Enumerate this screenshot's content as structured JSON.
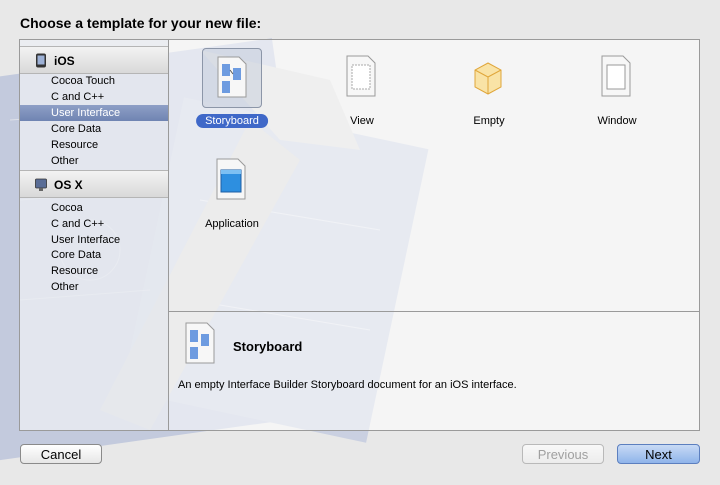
{
  "dialog": {
    "title": "Choose a template for your new file:"
  },
  "sidebar": {
    "groups": [
      {
        "label": "iOS",
        "icon": "ios-device-icon",
        "items": [
          "Cocoa Touch",
          "C and C++",
          "User Interface",
          "Core Data",
          "Resource",
          "Other"
        ],
        "selected_index": 2
      },
      {
        "label": "OS X",
        "icon": "mac-icon",
        "items": [
          "Cocoa",
          "C and C++",
          "User Interface",
          "Core Data",
          "Resource",
          "Other"
        ]
      }
    ]
  },
  "templates": [
    {
      "label": "Storyboard",
      "icon": "storyboard-icon",
      "selected": true
    },
    {
      "label": "View",
      "icon": "view-icon"
    },
    {
      "label": "Empty",
      "icon": "empty-cube-icon"
    },
    {
      "label": "Window",
      "icon": "window-icon"
    },
    {
      "label": "Application",
      "icon": "application-icon"
    }
  ],
  "detail": {
    "name": "Storyboard",
    "description": "An empty Interface Builder Storyboard document for an iOS interface.",
    "icon": "storyboard-icon"
  },
  "buttons": {
    "cancel": "Cancel",
    "previous": "Previous",
    "next": "Next"
  },
  "colors": {
    "selection_blue": "#3f68c8",
    "sidebar_selection": "#7d90bc",
    "default_button": "#8fb4ea"
  }
}
